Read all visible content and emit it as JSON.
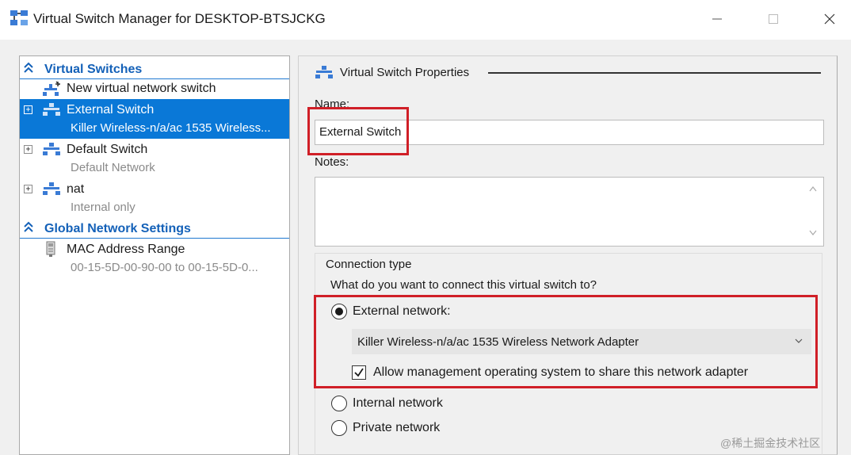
{
  "window": {
    "title": "Virtual Switch Manager for DESKTOP-BTSJCKG",
    "icon": "virtual-switch-manager-icon",
    "controls": [
      "minimize",
      "maximize",
      "close"
    ]
  },
  "left_pane": {
    "virtual_switches_header": "Virtual Switches",
    "items": [
      {
        "name": "New virtual network switch",
        "icon": "new-switch-icon"
      },
      {
        "name": "External Switch",
        "sub": "Killer Wireless-n/a/ac 1535 Wireless...",
        "selected": true,
        "expander": "+"
      },
      {
        "name": "Default Switch",
        "sub": "Default Network",
        "expander": "+"
      },
      {
        "name": "nat",
        "sub": "Internal only",
        "expander": "+"
      }
    ],
    "global_header": "Global Network Settings",
    "global_items": [
      {
        "name": "MAC Address Range",
        "sub": "00-15-5D-00-90-00 to 00-15-5D-0..."
      }
    ]
  },
  "properties": {
    "title": "Virtual Switch Properties",
    "name_label": "Name:",
    "name_value": "External Switch",
    "notes_label": "Notes:",
    "notes_value": "",
    "connection_type_label": "Connection type",
    "question": "What do you want to connect this virtual switch to?",
    "external_label": "External network:",
    "external_selected": true,
    "adapter_value": "Killer Wireless-n/a/ac 1535 Wireless Network Adapter",
    "allow_management_label": "Allow management operating system to share this network adapter",
    "allow_management_checked": true,
    "internal_label": "Internal network",
    "private_label": "Private network"
  },
  "watermark": "@稀土掘金技术社区",
  "colors": {
    "selection": "#0a78d7",
    "section_header": "#1461b8",
    "highlight_box": "#d01f27"
  }
}
